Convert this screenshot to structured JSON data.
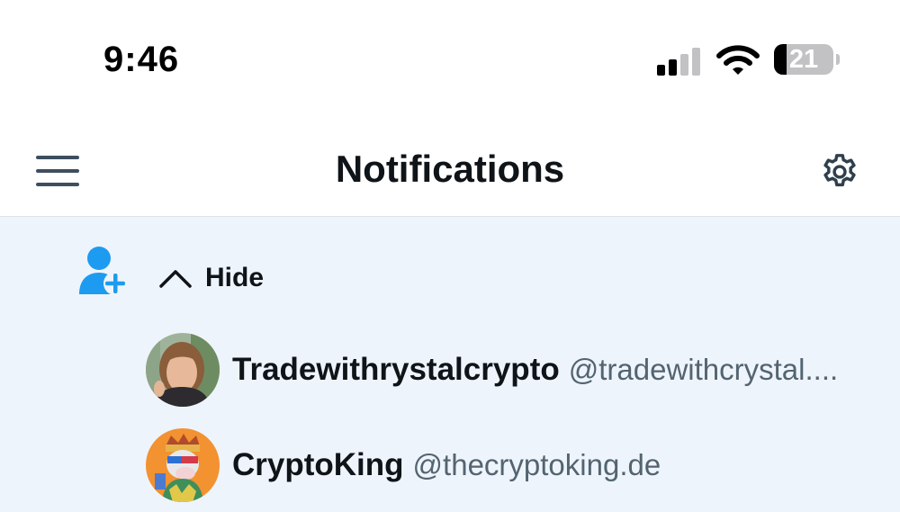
{
  "status_bar": {
    "time": "9:46",
    "battery_level": "21",
    "battery_fraction": 0.21,
    "signal_bars_active": 2,
    "signal_bars_total": 4,
    "icons": [
      "cellular-signal-icon",
      "wifi-icon",
      "battery-icon"
    ]
  },
  "header": {
    "title": "Notifications",
    "menu_icon": "hamburger-menu-icon",
    "settings_icon": "gear-icon"
  },
  "notification": {
    "type_icon": "person-add-icon",
    "accent_color": "#1d9bf0",
    "background_color": "#eef4fb",
    "toggle_icon": "chevron-up-icon",
    "toggle_label": "Hide",
    "users": [
      {
        "display_name": "Tradewithrystalcrypto",
        "handle": "@tradewithcrystal...."
      },
      {
        "display_name": "CryptoKing",
        "handle": "@thecryptoking.de"
      }
    ]
  }
}
